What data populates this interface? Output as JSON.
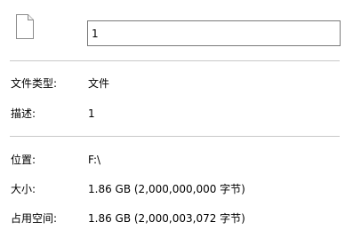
{
  "file": {
    "icon": "blank-file-icon",
    "name_value": "1"
  },
  "properties": {
    "type_label": "文件类型:",
    "type_value": "文件",
    "description_label": "描述:",
    "description_value": "1",
    "location_label": "位置:",
    "location_value": "F:\\",
    "size_label": "大小:",
    "size_value": "1.86 GB (2,000,000,000 字节)",
    "size_on_disk_label": "占用空间:",
    "size_on_disk_value": "1.86 GB (2,000,003,072 字节)"
  }
}
